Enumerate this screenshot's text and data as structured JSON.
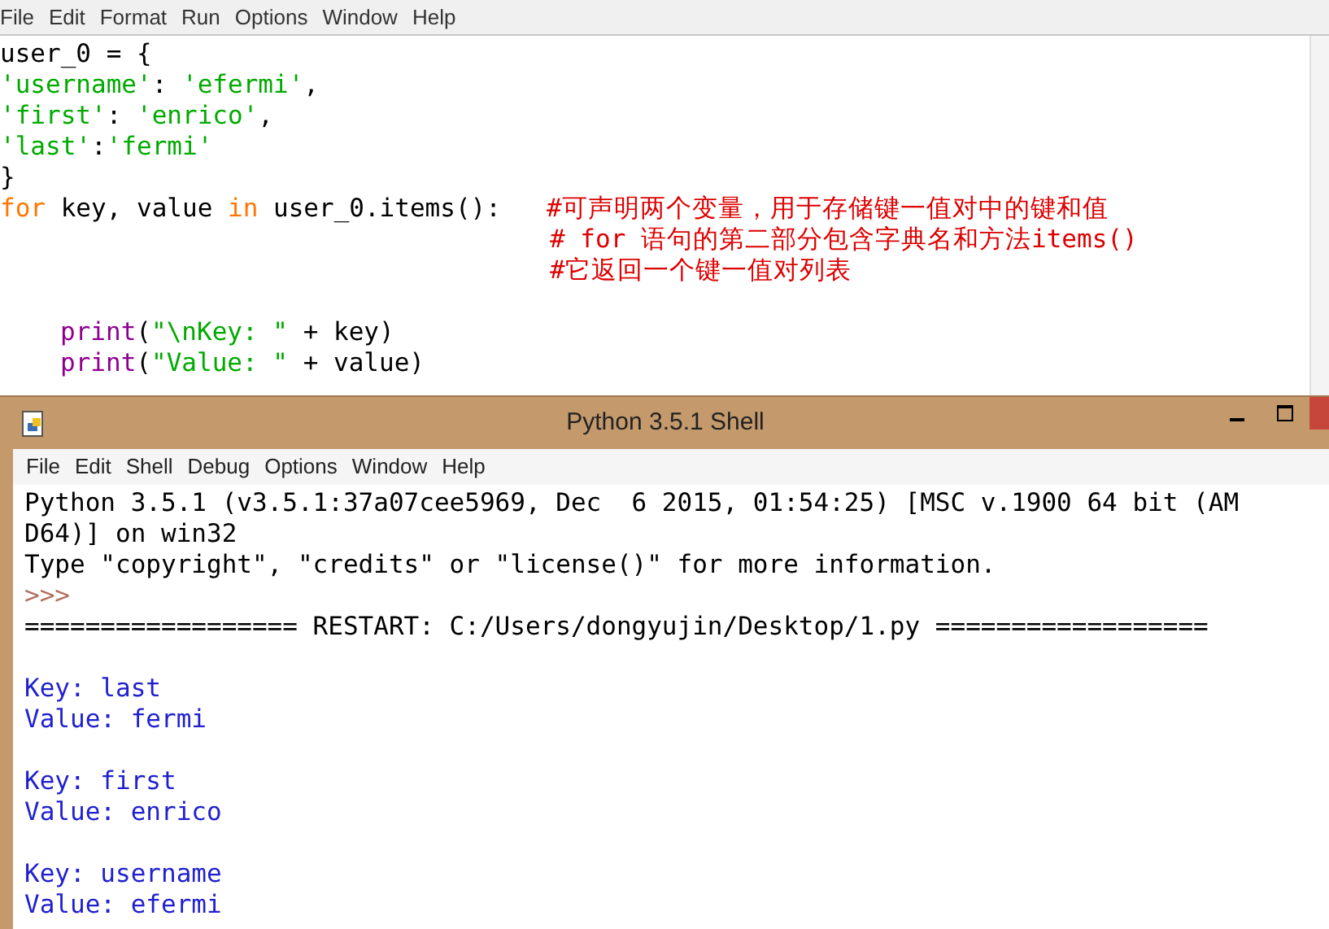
{
  "editor": {
    "menu": [
      "File",
      "Edit",
      "Format",
      "Run",
      "Options",
      "Window",
      "Help"
    ],
    "code_lines": [
      {
        "kind": "top",
        "segments": [
          {
            "text": "user_0 = {",
            "kind": "plain"
          }
        ]
      },
      {
        "kind": "top",
        "segments": [
          {
            "text": "'username'",
            "kind": "string"
          },
          {
            "text": ": ",
            "kind": "plain"
          },
          {
            "text": "'efermi'",
            "kind": "string"
          },
          {
            "text": ",",
            "kind": "plain"
          }
        ]
      },
      {
        "kind": "top",
        "segments": [
          {
            "text": "'first'",
            "kind": "string"
          },
          {
            "text": ": ",
            "kind": "plain"
          },
          {
            "text": "'enrico'",
            "kind": "string"
          },
          {
            "text": ",",
            "kind": "plain"
          }
        ]
      },
      {
        "kind": "top",
        "segments": [
          {
            "text": "'last'",
            "kind": "string"
          },
          {
            "text": ":",
            "kind": "plain"
          },
          {
            "text": "'fermi'",
            "kind": "string"
          }
        ]
      },
      {
        "kind": "top",
        "segments": [
          {
            "text": "}",
            "kind": "plain"
          }
        ]
      },
      {
        "kind": "top",
        "segments": [
          {
            "text": "for",
            "kind": "keyword"
          },
          {
            "text": " key, value ",
            "kind": "plain"
          },
          {
            "text": "in",
            "kind": "keyword"
          },
          {
            "text": " user_0.items():   ",
            "kind": "plain"
          },
          {
            "text": "#可声明两个变量，用于存储键一值对中的键和值",
            "kind": "comment"
          }
        ]
      },
      {
        "kind": "comment_column",
        "segments": [
          {
            "text": "# for 语句的第二部分包含字典名和方法items()",
            "kind": "comment"
          }
        ]
      },
      {
        "kind": "comment_column",
        "segments": [
          {
            "text": "#它返回一个键一值对列表",
            "kind": "comment"
          }
        ]
      },
      {
        "kind": "blank"
      },
      {
        "kind": "body",
        "segments": [
          {
            "text": "print",
            "kind": "builtin"
          },
          {
            "text": "(",
            "kind": "plain"
          },
          {
            "text": "\"\\nKey: \"",
            "kind": "string"
          },
          {
            "text": " + key)",
            "kind": "plain"
          }
        ]
      },
      {
        "kind": "body",
        "segments": [
          {
            "text": "print",
            "kind": "builtin"
          },
          {
            "text": "(",
            "kind": "plain"
          },
          {
            "text": "\"Value: \"",
            "kind": "string"
          },
          {
            "text": " + value)",
            "kind": "plain"
          }
        ]
      }
    ]
  },
  "shell": {
    "title": "Python 3.5.1 Shell",
    "menu": [
      "File",
      "Edit",
      "Shell",
      "Debug",
      "Options",
      "Window",
      "Help"
    ],
    "lines": [
      {
        "text": "Python 3.5.1 (v3.5.1:37a07cee5969, Dec  6 2015, 01:54:25) [MSC v.1900 64 bit (AM",
        "kind": "plain"
      },
      {
        "text": "D64)] on win32",
        "kind": "plain"
      },
      {
        "text": "Type \"copyright\", \"credits\" or \"license()\" for more information.",
        "kind": "plain"
      },
      {
        "text": ">>>",
        "kind": "prompt"
      },
      {
        "text": "================== RESTART: C:/Users/dongyujin/Desktop/1.py ==================",
        "kind": "plain"
      },
      {
        "kind": "blank"
      },
      {
        "text": "Key: last",
        "kind": "output"
      },
      {
        "text": "Value: fermi",
        "kind": "output"
      },
      {
        "kind": "blank"
      },
      {
        "text": "Key: first",
        "kind": "output"
      },
      {
        "text": "Value: enrico",
        "kind": "output"
      },
      {
        "kind": "blank"
      },
      {
        "text": "Key: username",
        "kind": "output"
      },
      {
        "text": "Value: efermi",
        "kind": "output"
      }
    ]
  }
}
